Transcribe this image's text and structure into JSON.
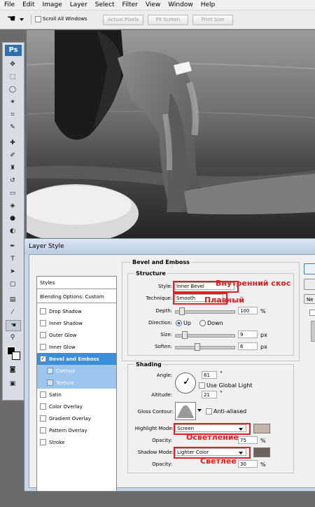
{
  "menubar": {
    "items": [
      "File",
      "Edit",
      "Image",
      "Layer",
      "Select",
      "Filter",
      "View",
      "Window",
      "Help"
    ]
  },
  "options": {
    "scroll_all_windows": "Scroll All Windows",
    "actual_pixels": "Actual Pixels",
    "fit_screen": "Fit Screen",
    "print_size": "Print Size"
  },
  "toolbox": {
    "logo": "Ps"
  },
  "dialog": {
    "title": "Layer Style",
    "styles_header": "Styles",
    "blending_options": "Blending Options: Custom",
    "style_items": [
      "Drop Shadow",
      "Inner Shadow",
      "Outer Glow",
      "Inner Glow",
      "Bevel and Emboss",
      "Contour",
      "Texture",
      "Satin",
      "Color Overlay",
      "Gradient Overlay",
      "Pattern Overlay",
      "Stroke"
    ],
    "selected_item": "Bevel and Emboss",
    "bevel": {
      "section_title": "Bevel and Emboss",
      "structure_title": "Structure",
      "style_label": "Style:",
      "style_value": "Inner Bevel",
      "technique_label": "Technique:",
      "technique_value": "Smooth",
      "depth_label": "Depth:",
      "depth_value": "100",
      "depth_unit": "%",
      "direction_label": "Direction:",
      "direction_up": "Up",
      "direction_down": "Down",
      "size_label": "Size:",
      "size_value": "9",
      "size_unit": "px",
      "soften_label": "Soften:",
      "soften_value": "6",
      "soften_unit": "px"
    },
    "shading": {
      "title": "Shading",
      "angle_label": "Angle:",
      "angle_value": "61",
      "angle_unit": "°",
      "use_global_light": "Use Global Light",
      "altitude_label": "Altitude:",
      "altitude_value": "21",
      "altitude_unit": "°",
      "gloss_contour_label": "Gloss Contour:",
      "anti_aliased": "Anti-aliased",
      "highlight_mode_label": "Highlight Mode:",
      "highlight_mode_value": "Screen",
      "highlight_opacity_label": "Opacity:",
      "highlight_opacity_value": "75",
      "highlight_opacity_unit": "%",
      "shadow_mode_label": "Shadow Mode:",
      "shadow_mode_value": "Lighter Color",
      "shadow_opacity_label": "Opacity:",
      "shadow_opacity_value": "30",
      "shadow_opacity_unit": "%"
    },
    "right_buttons": {
      "new_partial": "Ne"
    }
  },
  "annotations": {
    "inner_bevel": "Внутренний скос",
    "smooth": "Плавный",
    "screen": "Осветление",
    "lighter_color": "Светлее"
  },
  "colors": {
    "highlight_swatch": "#c4b5ab",
    "shadow_swatch": "#6e625c",
    "accent": "#3b8fd9",
    "annotation_red": "#e32020"
  }
}
